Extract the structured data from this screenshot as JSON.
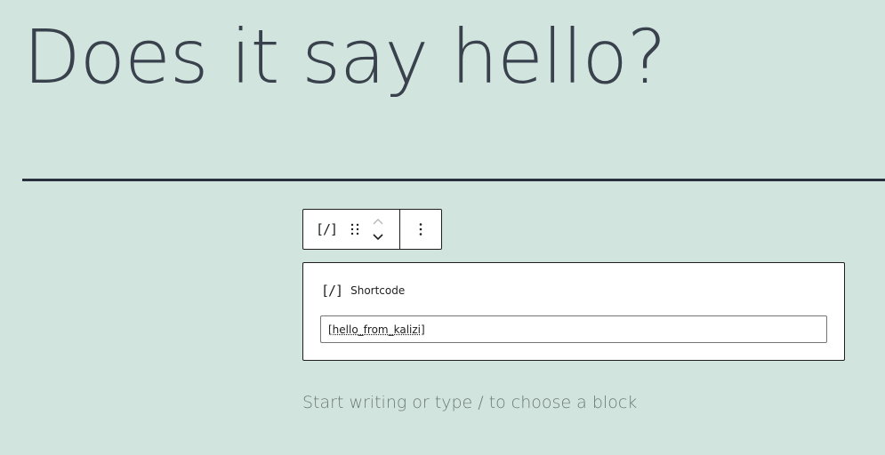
{
  "post": {
    "title": "Does it say hello?"
  },
  "toolbar": {
    "block_icon_text": "[/]",
    "drag_icon": "drag-handle-icon",
    "move_up_icon": "chevron-up-icon",
    "move_down_icon": "chevron-down-icon",
    "more_icon": "more-vertical-icon"
  },
  "shortcode_block": {
    "icon_text": "[/]",
    "label": "Shortcode",
    "value": "[hello_from_kalizi]"
  },
  "appender": {
    "placeholder": "Start writing or type / to choose a block"
  },
  "colors": {
    "background": "#d1e4dd",
    "text": "#28303d",
    "border": "#1e1e1e"
  }
}
